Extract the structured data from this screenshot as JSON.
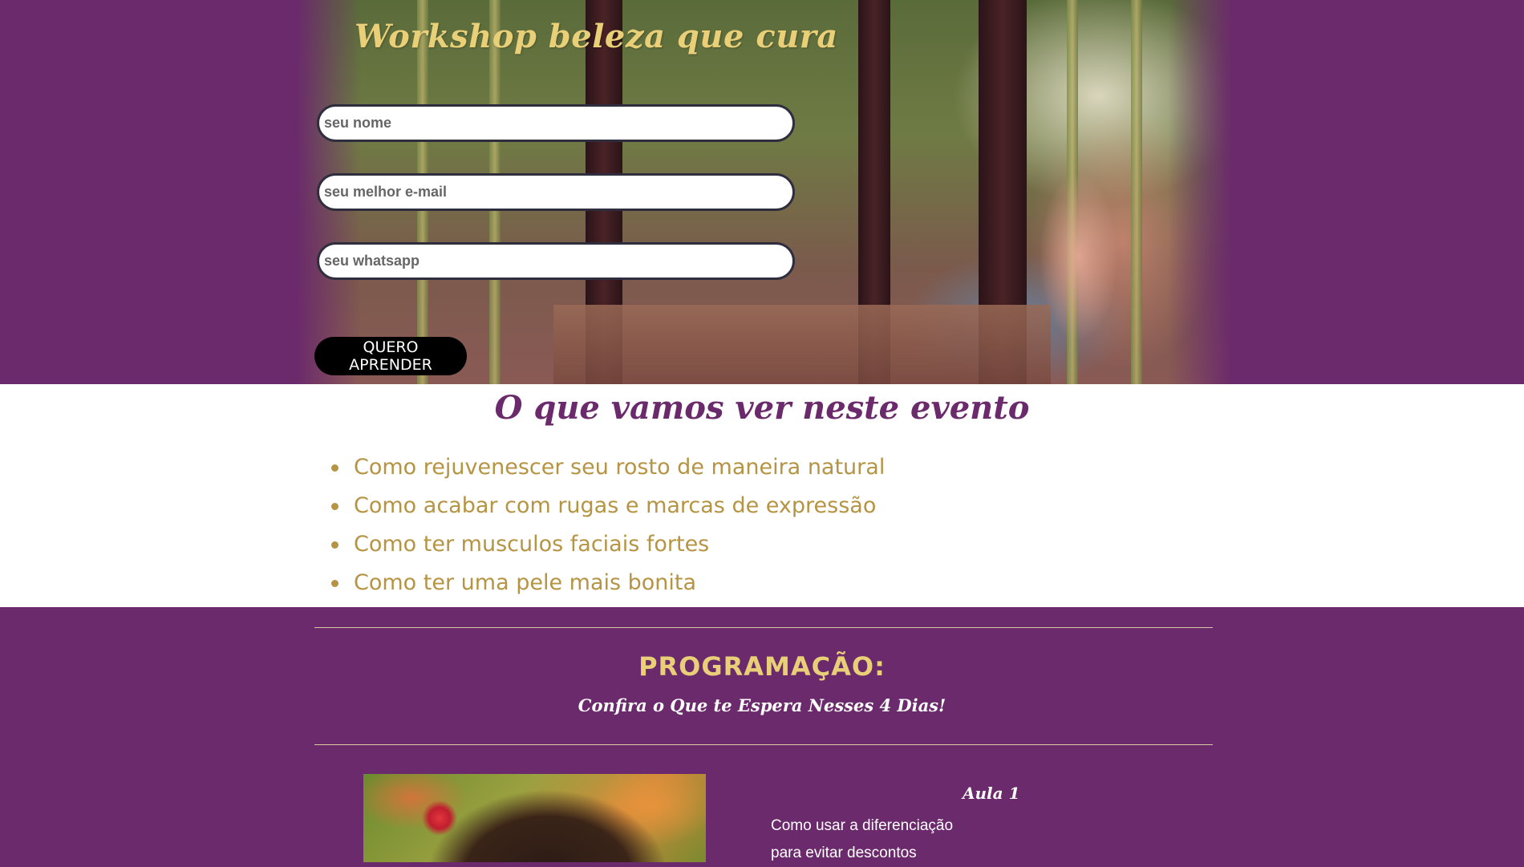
{
  "hero": {
    "title": "Workshop beleza que cura",
    "fields": {
      "name_placeholder": "seu nome",
      "email_placeholder": "seu melhor e-mail",
      "whatsapp_placeholder": "seu whatsapp"
    },
    "cta_label": "QUERO APRENDER"
  },
  "topics": {
    "heading": "O que vamos ver neste evento",
    "items": [
      "Como rejuvenescer seu rosto de maneira natural",
      "Como acabar com rugas e marcas de expressão",
      "Como ter musculos faciais fortes",
      "Como ter uma pele mais bonita"
    ]
  },
  "program": {
    "title": "PROGRAMAÇÃO:",
    "subtitle": "Confira o Que te Espera Nesses 4 Dias!",
    "lesson": {
      "label": "Aula 1",
      "description_lines": [
        "Como usar a diferenciação",
        "para evitar descontos"
      ]
    }
  },
  "colors": {
    "purple_bg": "#6b2a6b",
    "gold_text": "#e8cf78",
    "topic_text": "#b59443",
    "white": "#ffffff",
    "cta_bg": "#000000"
  }
}
